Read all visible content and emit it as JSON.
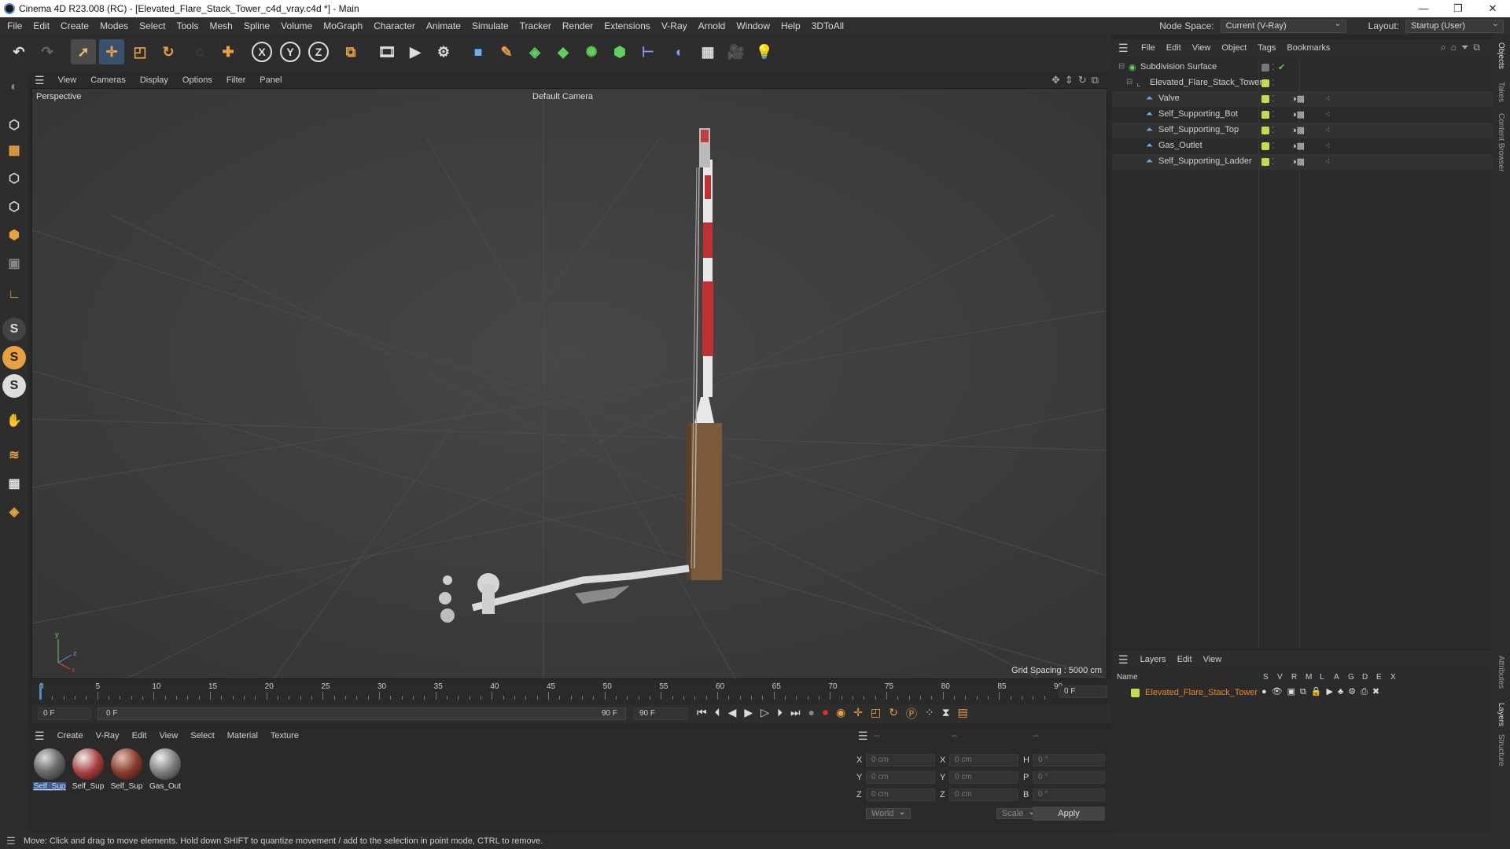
{
  "window": {
    "title": "Cinema 4D R23.008 (RC) - [Elevated_Flare_Stack_Tower_c4d_vray.c4d *] - Main",
    "controls": [
      "—",
      "❐",
      "✕"
    ]
  },
  "menu": [
    "File",
    "Edit",
    "Create",
    "Modes",
    "Select",
    "Tools",
    "Mesh",
    "Spline",
    "Volume",
    "MoGraph",
    "Character",
    "Animate",
    "Simulate",
    "Tracker",
    "Render",
    "Extensions",
    "V-Ray",
    "Arnold",
    "Window",
    "Help",
    "3DToAll"
  ],
  "node_space": {
    "label": "Node Space:",
    "value": "Current (V-Ray)"
  },
  "layout": {
    "label": "Layout:",
    "value": "Startup (User)"
  },
  "viewport": {
    "menu": [
      "View",
      "Cameras",
      "Display",
      "Options",
      "Filter",
      "Panel"
    ],
    "view_name": "Perspective",
    "camera": "Default Camera",
    "grid_spacing": "Grid Spacing : 5000 cm"
  },
  "timeline": {
    "ticks": [
      "0",
      "5",
      "10",
      "15",
      "20",
      "25",
      "30",
      "35",
      "40",
      "45",
      "50",
      "55",
      "60",
      "65",
      "70",
      "75",
      "80",
      "85",
      "90"
    ],
    "current_frame": "0 F"
  },
  "transport": {
    "start": "0 F",
    "range_start": "0 F",
    "range_end": "90 F",
    "end": "90 F"
  },
  "material_panel": {
    "menu": [
      "Create",
      "V-Ray",
      "Edit",
      "View",
      "Select",
      "Material",
      "Texture"
    ],
    "materials": [
      {
        "label": "Self_Sup",
        "color": "#6e6e6e",
        "selected": true
      },
      {
        "label": "Self_Sup",
        "color": "#a84040",
        "selected": false
      },
      {
        "label": "Self_Sup",
        "color": "#8a3a30",
        "selected": false
      },
      {
        "label": "Gas_Out",
        "color": "#7c7c7c",
        "selected": false
      }
    ]
  },
  "coord_panel": {
    "headers": [
      "--",
      "--",
      "--"
    ],
    "rows": [
      {
        "a": "X",
        "av": "0 cm",
        "b": "X",
        "bv": "0 cm",
        "c": "H",
        "cv": "0 °"
      },
      {
        "a": "Y",
        "av": "0 cm",
        "b": "Y",
        "bv": "0 cm",
        "c": "P",
        "cv": "0 °"
      },
      {
        "a": "Z",
        "av": "0 cm",
        "b": "Z",
        "bv": "0 cm",
        "c": "B",
        "cv": "0 °"
      }
    ],
    "mode": "World",
    "transform": "Scale",
    "apply": "Apply"
  },
  "object_manager": {
    "menu": [
      "File",
      "Edit",
      "View",
      "Object",
      "Tags",
      "Bookmarks"
    ],
    "objects": [
      {
        "name": "Subdivision Surface",
        "level": 0,
        "dot": "#9a9a9a"
      },
      {
        "name": "Elevated_Flare_Stack_Tower",
        "level": 1,
        "dot": "#c8d94a"
      },
      {
        "name": "Valve",
        "level": 2,
        "dot": "#c8d94a"
      },
      {
        "name": "Self_Supporting_Bot",
        "level": 2,
        "dot": "#c8d94a"
      },
      {
        "name": "Self_Supporting_Top",
        "level": 2,
        "dot": "#c8d94a"
      },
      {
        "name": "Gas_Outlet",
        "level": 2,
        "dot": "#c8d94a"
      },
      {
        "name": "Self_Supporting_Ladder",
        "level": 2,
        "dot": "#c8d94a"
      }
    ]
  },
  "layer_manager": {
    "menu": [
      "Layers",
      "Edit",
      "View"
    ],
    "columns": [
      "Name",
      "S",
      "V",
      "R",
      "M",
      "L",
      "A",
      "G",
      "D",
      "E",
      "X"
    ],
    "layers": [
      {
        "name": "Elevated_Flare_Stack_Tower",
        "color": "#c8d94a"
      }
    ]
  },
  "right_tabs": [
    "Objects",
    "Takes",
    "Content Browser",
    "Attributes",
    "Layers",
    "Structure"
  ],
  "status": "Move: Click and drag to move elements. Hold down SHIFT to quantize movement / add to the selection in point mode, CTRL to remove.",
  "colors": {
    "accent": "#e8852b",
    "bg": "#2b2b2b",
    "viewport": "#3c3c3c"
  }
}
